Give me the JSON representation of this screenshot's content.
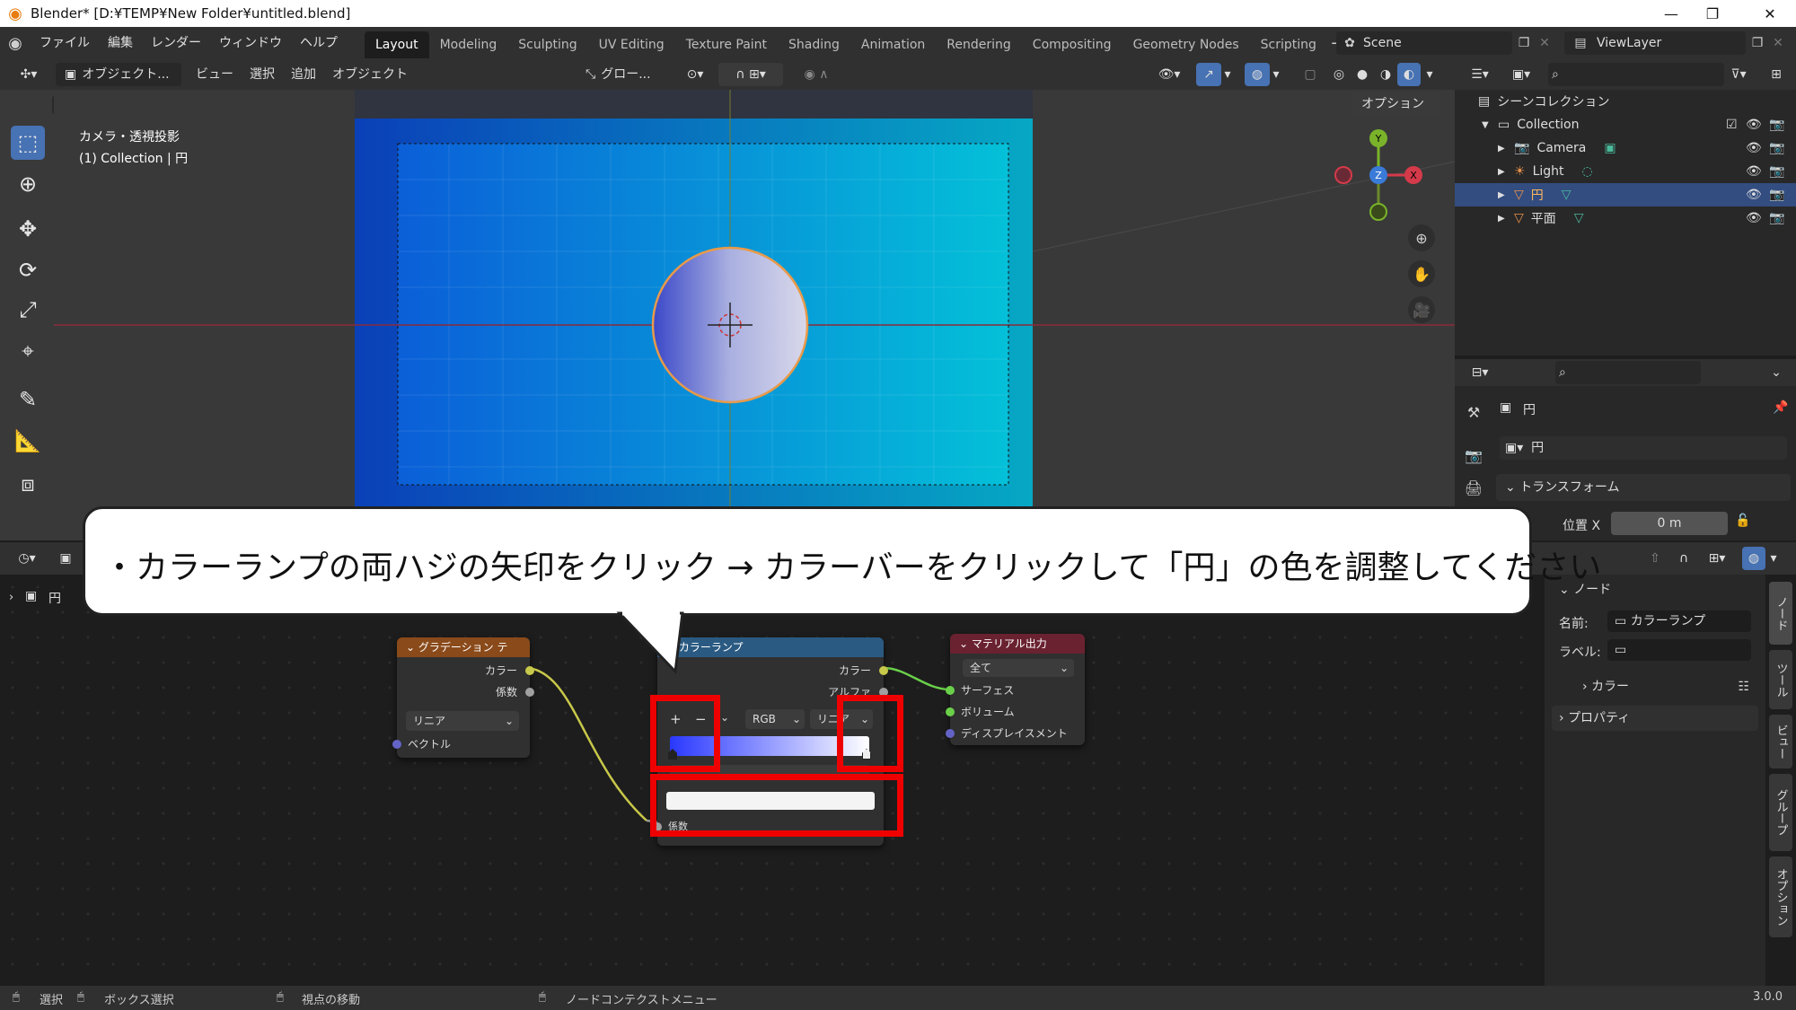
{
  "titlebar": {
    "title": "Blender* [D:¥TEMP¥New Folder¥untitled.blend]",
    "min": "—",
    "restore": "❐",
    "close": "✕"
  },
  "menus": [
    "ファイル",
    "編集",
    "レンダー",
    "ウィンドウ",
    "ヘルプ"
  ],
  "workspaces": [
    "Layout",
    "Modeling",
    "Sculpting",
    "UV Editing",
    "Texture Paint",
    "Shading",
    "Animation",
    "Rendering",
    "Compositing",
    "Geometry Nodes",
    "Scripting"
  ],
  "scene": {
    "label": "Scene",
    "viewlayer": "ViewLayer"
  },
  "view3d_header": {
    "mode": "オブジェクト...",
    "menus": [
      "ビュー",
      "選択",
      "追加",
      "オブジェクト"
    ],
    "transform": "グロー...",
    "options": "オプション"
  },
  "viewport": {
    "camera_label": "カメラ・透視投影",
    "collection_label": "(1) Collection | 円"
  },
  "gizmo": {
    "x": "X",
    "y": "Y",
    "z": "Z"
  },
  "outliner": {
    "title": "シーンコレクション",
    "items": [
      {
        "label": "Collection",
        "type": "collection"
      },
      {
        "label": "Camera",
        "type": "camera"
      },
      {
        "label": "Light",
        "type": "light"
      },
      {
        "label": "円",
        "type": "mesh",
        "selected": true
      },
      {
        "label": "平面",
        "type": "mesh"
      }
    ]
  },
  "properties": {
    "object_name": "円",
    "data_name": "円",
    "section": "トランスフォーム",
    "position_label": "位置 X",
    "position_value": "0 m"
  },
  "node_header": {
    "object": "円"
  },
  "nodes": {
    "gradient": {
      "title": "グラデーション テ",
      "out_color": "カラー",
      "out_fac": "係数",
      "type": "リニア",
      "in_vector": "ベクトル"
    },
    "ramp": {
      "title": "カラーランプ",
      "out_color": "カラー",
      "out_alpha": "アルファ",
      "add": "+",
      "remove": "−",
      "mode": "RGB",
      "interp": "リニア",
      "in_fac": "係数"
    },
    "output": {
      "title": "マテリアル出力",
      "target": "全て",
      "in_surface": "サーフェス",
      "in_volume": "ボリューム",
      "in_displace": "ディスプレイスメント"
    }
  },
  "node_sidebar": {
    "section": "ノード",
    "name_label": "名前:",
    "name_value": "カラーランプ",
    "label_label": "ラベル:",
    "color_section": "カラー",
    "properties_section": "プロパティ",
    "tabs": [
      "ノード",
      "ツール",
      "ビュー",
      "グループ",
      "オプション"
    ]
  },
  "callout": {
    "text": "・カラーランプの両ハジの矢印をクリック → カラーバーをクリックして「円」の色を調整してください"
  },
  "status": {
    "select": "選択",
    "box_select": "ボックス選択",
    "move_view": "視点の移動",
    "context_menu": "ノードコンテクストメニュー",
    "version": "3.0.0"
  }
}
